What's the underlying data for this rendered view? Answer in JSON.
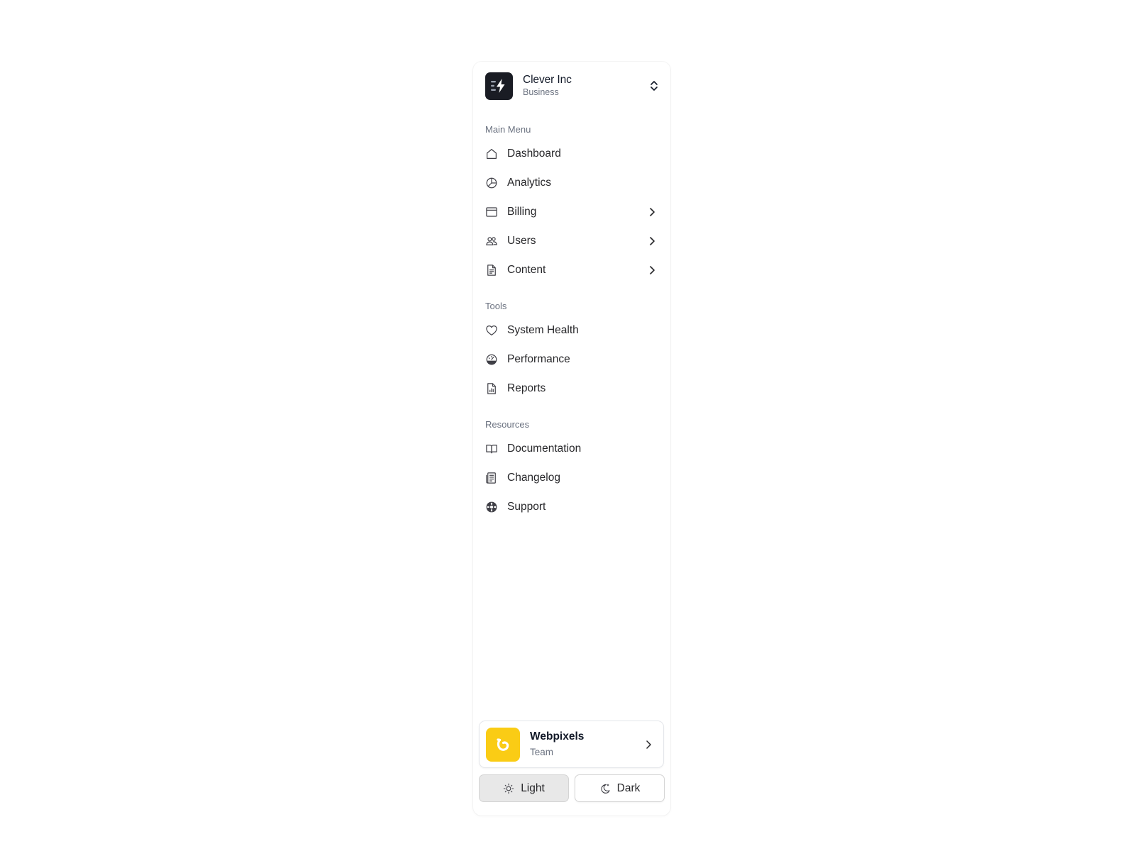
{
  "org": {
    "name": "Clever Inc",
    "plan": "Business",
    "logo_icon": "bolt-icon",
    "switch_icon": "chevron-up-down-icon"
  },
  "sections": {
    "main_menu": {
      "title": "Main Menu",
      "items": [
        {
          "label": "Dashboard",
          "icon": "home-icon",
          "has_submenu": false
        },
        {
          "label": "Analytics",
          "icon": "pie-chart-icon",
          "has_submenu": false
        },
        {
          "label": "Billing",
          "icon": "browser-window-icon",
          "has_submenu": true
        },
        {
          "label": "Users",
          "icon": "users-icon",
          "has_submenu": true
        },
        {
          "label": "Content",
          "icon": "document-text-icon",
          "has_submenu": true
        }
      ]
    },
    "tools": {
      "title": "Tools",
      "items": [
        {
          "label": "System Health",
          "icon": "heart-icon"
        },
        {
          "label": "Performance",
          "icon": "gauge-icon"
        },
        {
          "label": "Reports",
          "icon": "document-chart-icon"
        }
      ]
    },
    "resources": {
      "title": "Resources",
      "items": [
        {
          "label": "Documentation",
          "icon": "book-open-icon"
        },
        {
          "label": "Changelog",
          "icon": "newspaper-icon"
        },
        {
          "label": "Support",
          "icon": "lifebuoy-icon"
        }
      ]
    }
  },
  "team": {
    "name": "Webpixels",
    "role": "Team",
    "logo_color": "#facc15",
    "logo_icon": "webpixels-logo"
  },
  "theme": {
    "light_label": "Light",
    "dark_label": "Dark",
    "selected": "Light"
  }
}
